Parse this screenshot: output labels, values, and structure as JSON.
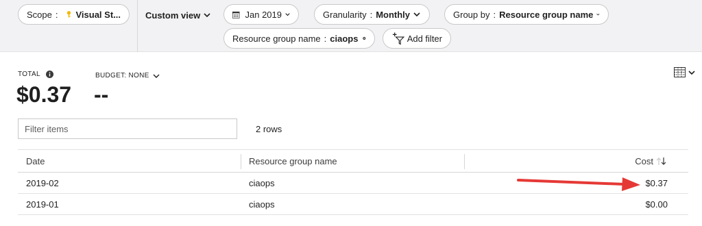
{
  "toolbar": {
    "scope": {
      "label": "Scope",
      "sep": ":",
      "value": "Visual St..."
    },
    "custom_view": "Custom view",
    "date_range": "Jan 2019",
    "granularity": {
      "label": "Granularity",
      "sep": ":",
      "value": "Monthly"
    },
    "group_by": {
      "label": "Group by",
      "sep": ":",
      "value": "Resource group name"
    },
    "filter_chip": {
      "label": "Resource group name",
      "sep": ":",
      "value": "ciaops"
    },
    "add_filter": "Add filter"
  },
  "summary": {
    "total_label": "TOTAL",
    "total_value": "$0.37",
    "budget_label": "BUDGET: NONE",
    "budget_value": "--"
  },
  "filter": {
    "placeholder": "Filter items"
  },
  "row_count": "2 rows",
  "table": {
    "columns": [
      "Date",
      "Resource group name",
      "Cost"
    ],
    "rows": [
      {
        "date": "2019-02",
        "group": "ciaops",
        "cost": "$0.37"
      },
      {
        "date": "2019-01",
        "group": "ciaops",
        "cost": "$0.00"
      }
    ]
  },
  "colors": {
    "accent_arrow": "#e53935",
    "key_icon": "#f2b705"
  },
  "icons": [
    "key-icon",
    "calendar-icon",
    "chevron-down-icon",
    "clear-icon",
    "add-filter-icon",
    "info-icon",
    "column-chooser-icon",
    "sort-icon"
  ]
}
